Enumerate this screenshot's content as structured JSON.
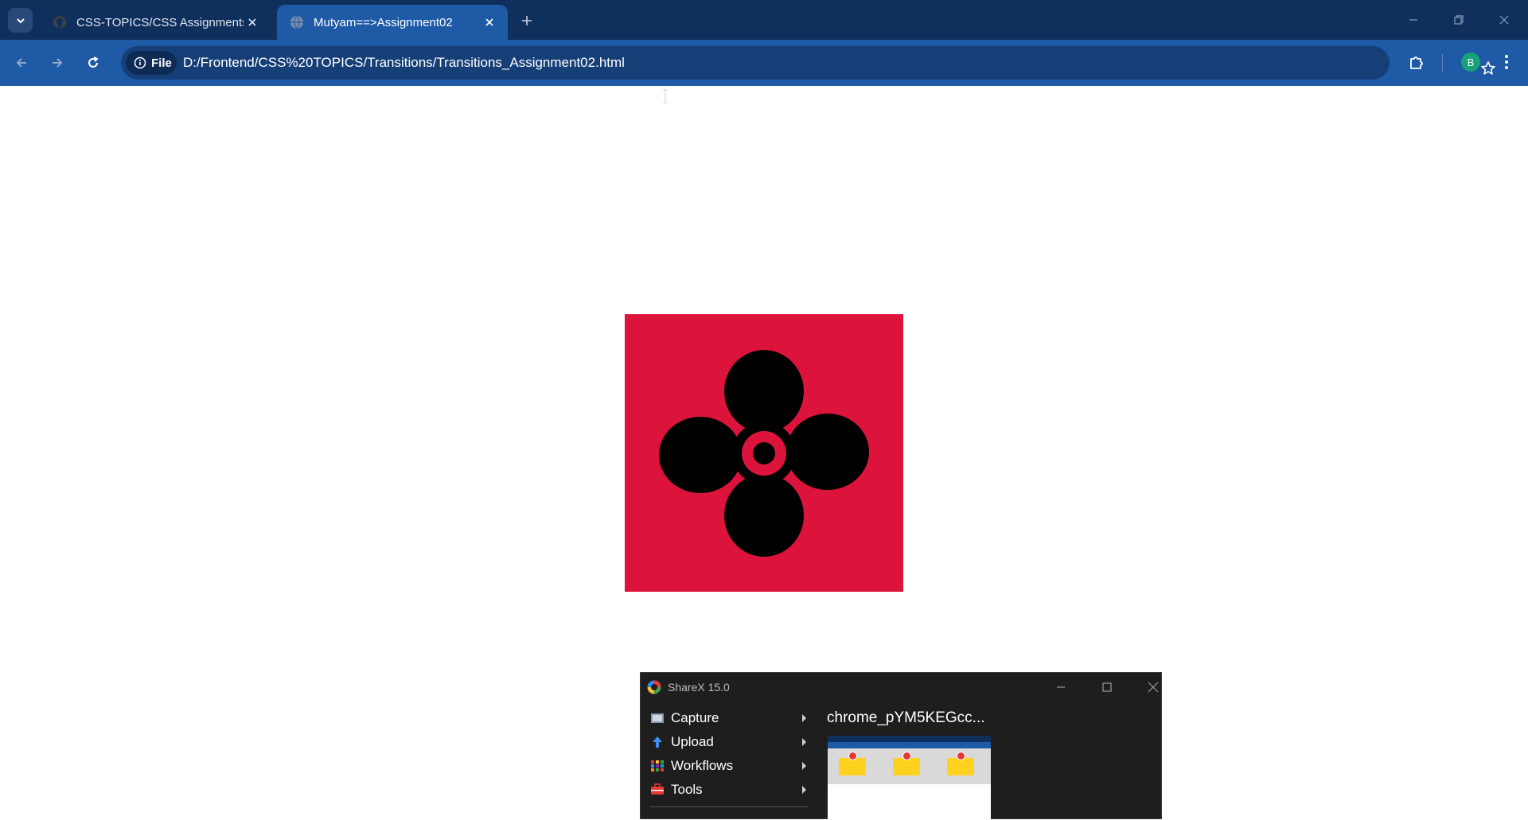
{
  "browser": {
    "tabs": [
      {
        "title": "CSS-TOPICS/CSS Assignments/Transitions",
        "active": false,
        "icon": "github-icon"
      },
      {
        "title": "Mutyam==>Assignment02",
        "active": true,
        "icon": "globe-icon"
      }
    ],
    "address_chip": "File",
    "url": "D:/Frontend/CSS%20TOPICS/Transitions/Transitions_Assignment02.html",
    "profile_initial": "B",
    "colors": {
      "titlebar": "#0f2f5c",
      "toolbar": "#1f5aa6",
      "omnibox": "#163f78"
    }
  },
  "page": {
    "fan_box": {
      "background": "#dc143c",
      "icon": "fan-icon",
      "icon_color": "#000000"
    }
  },
  "sharex": {
    "title": "ShareX 15.0",
    "menu": [
      {
        "label": "Capture",
        "icon": "capture-icon"
      },
      {
        "label": "Upload",
        "icon": "upload-icon"
      },
      {
        "label": "Workflows",
        "icon": "workflows-icon"
      },
      {
        "label": "Tools",
        "icon": "tools-icon"
      }
    ],
    "recent_file": "chrome_pYM5KEGcc..."
  }
}
